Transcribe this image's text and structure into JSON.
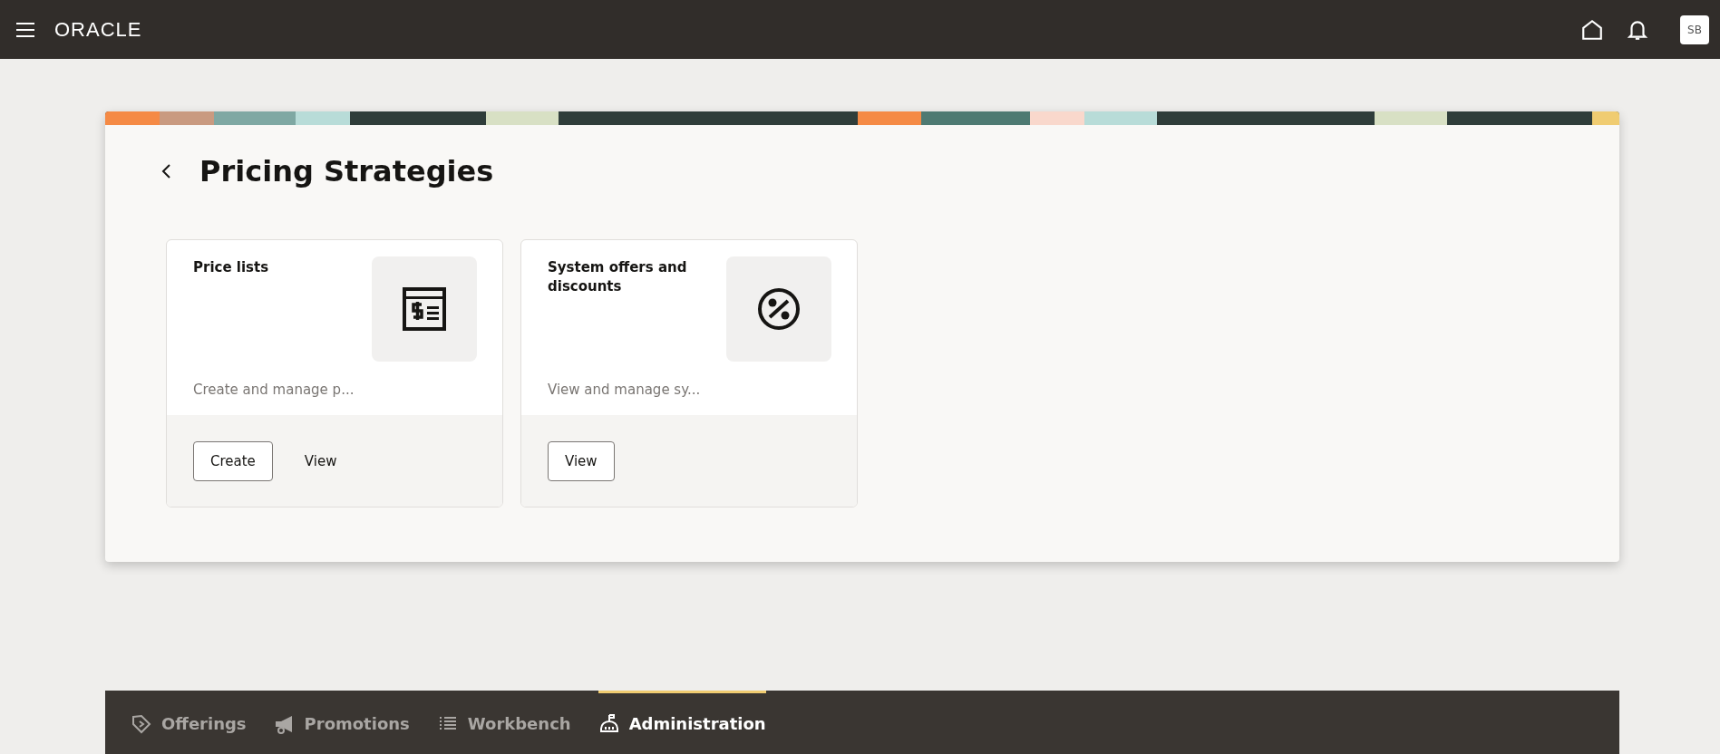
{
  "header": {
    "logo": "ORACLE",
    "avatar": "SB"
  },
  "page": {
    "title": "Pricing Strategies"
  },
  "cards": [
    {
      "title": "Price lists",
      "description": "Create and manage p...",
      "actions": [
        {
          "label": "Create",
          "kind": "outlined"
        },
        {
          "label": "View",
          "kind": "text"
        }
      ]
    },
    {
      "title": "System offers and discounts",
      "description": "View and manage sy...",
      "actions": [
        {
          "label": "View",
          "kind": "outlined"
        }
      ]
    }
  ],
  "nav": [
    {
      "label": "Offerings",
      "selected": false
    },
    {
      "label": "Promotions",
      "selected": false
    },
    {
      "label": "Workbench",
      "selected": false
    },
    {
      "label": "Administration",
      "selected": true
    }
  ]
}
